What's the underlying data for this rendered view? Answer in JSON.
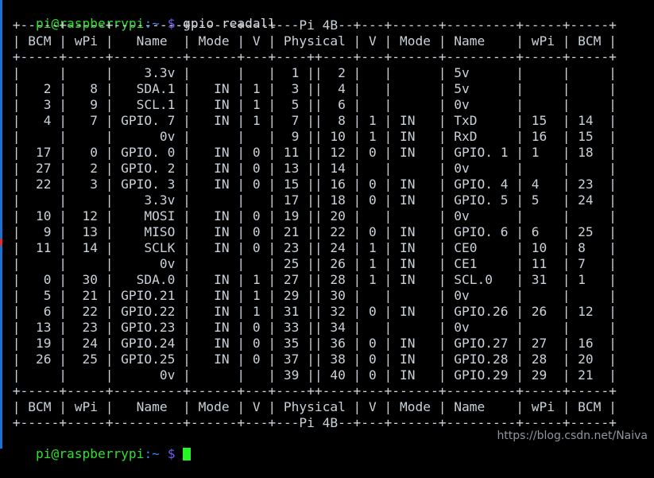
{
  "terminal": {
    "prompt": {
      "user_host": "pi@raspberrypi",
      "path": ":~",
      "dollar": "$"
    },
    "command": " gpio readall",
    "board": "Pi 4B",
    "watermark": "https://blog.csdn.net/Naiva",
    "colors": {
      "background": "#000000",
      "text": "#c9d1d9",
      "prompt_user": "#2ee02e",
      "prompt_path": "#3b82f6",
      "prompt_dollar": "#6f5cf0",
      "cursor": "#25f425",
      "scrollbar": "#1f6fd0",
      "scroll_mark": "#d83030"
    },
    "lines": [
      " +-----+-----+---------+------+---+---Pi 4B--+---+------+---------+-----+-----+",
      " | BCM | wPi |   Name  | Mode | V | Physical | V | Mode | Name    | wPi | BCM |",
      " +-----+-----+---------+------+---+----++----+---+------+---------+-----+-----+",
      " |     |     |    3.3v |      |   |  1 ||  2 |   |      | 5v      |     |     |",
      " |   2 |   8 |   SDA.1 |   IN | 1 |  3 ||  4 |   |      | 5v      |     |     |",
      " |   3 |   9 |   SCL.1 |   IN | 1 |  5 ||  6 |   |      | 0v      |     |     |",
      " |   4 |   7 | GPIO. 7 |   IN | 1 |  7 ||  8 | 1 | IN   | TxD     | 15  | 14  |",
      " |     |     |      0v |      |   |  9 || 10 | 1 | IN   | RxD     | 16  | 15  |",
      " |  17 |   0 | GPIO. 0 |   IN | 0 | 11 || 12 | 0 | IN   | GPIO. 1 | 1   | 18  |",
      " |  27 |   2 | GPIO. 2 |   IN | 0 | 13 || 14 |   |      | 0v      |     |     |",
      " |  22 |   3 | GPIO. 3 |   IN | 0 | 15 || 16 | 0 | IN   | GPIO. 4 | 4   | 23  |",
      " |     |     |    3.3v |      |   | 17 || 18 | 0 | IN   | GPIO. 5 | 5   | 24  |",
      " |  10 |  12 |    MOSI |   IN | 0 | 19 || 20 |   |      | 0v      |     |     |",
      " |   9 |  13 |    MISO |   IN | 0 | 21 || 22 | 0 | IN   | GPIO. 6 | 6   | 25  |",
      " |  11 |  14 |    SCLK |   IN | 0 | 23 || 24 | 1 | IN   | CE0     | 10  | 8   |",
      " |     |     |      0v |      |   | 25 || 26 | 1 | IN   | CE1     | 11  | 7   |",
      " |   0 |  30 |   SDA.0 |   IN | 1 | 27 || 28 | 1 | IN   | SCL.0   | 31  | 1   |",
      " |   5 |  21 | GPIO.21 |   IN | 1 | 29 || 30 |   |      | 0v      |     |     |",
      " |   6 |  22 | GPIO.22 |   IN | 1 | 31 || 32 | 0 | IN   | GPIO.26 | 26  | 12  |",
      " |  13 |  23 | GPIO.23 |   IN | 0 | 33 || 34 |   |      | 0v      |     |     |",
      " |  19 |  24 | GPIO.24 |   IN | 0 | 35 || 36 | 0 | IN   | GPIO.27 | 27  | 16  |",
      " |  26 |  25 | GPIO.25 |   IN | 0 | 37 || 38 | 0 | IN   | GPIO.28 | 28  | 20  |",
      " |     |     |      0v |      |   | 39 || 40 | 0 | IN   | GPIO.29 | 29  | 21  |",
      " +-----+-----+---------+------+---+----++----+---+------+---------+-----+-----+",
      " | BCM | wPi |   Name  | Mode | V | Physical | V | Mode | Name    | wPi | BCM |",
      " +-----+-----+---------+------+---+---Pi 4B--+---+------+---------+-----+-----+"
    ],
    "table": {
      "headers": [
        "BCM",
        "wPi",
        "Name",
        "Mode",
        "V",
        "Physical",
        "V",
        "Mode",
        "Name",
        "wPi",
        "BCM"
      ],
      "rows": [
        {
          "bcm_l": "",
          "wpi_l": "",
          "name_l": "3.3v",
          "mode_l": "",
          "v_l": "",
          "phys_l": "1",
          "phys_r": "2",
          "v_r": "",
          "mode_r": "",
          "name_r": "5v",
          "wpi_r": "",
          "bcm_r": ""
        },
        {
          "bcm_l": "2",
          "wpi_l": "8",
          "name_l": "SDA.1",
          "mode_l": "IN",
          "v_l": "1",
          "phys_l": "3",
          "phys_r": "4",
          "v_r": "",
          "mode_r": "",
          "name_r": "5v",
          "wpi_r": "",
          "bcm_r": ""
        },
        {
          "bcm_l": "3",
          "wpi_l": "9",
          "name_l": "SCL.1",
          "mode_l": "IN",
          "v_l": "1",
          "phys_l": "5",
          "phys_r": "6",
          "v_r": "",
          "mode_r": "",
          "name_r": "0v",
          "wpi_r": "",
          "bcm_r": ""
        },
        {
          "bcm_l": "4",
          "wpi_l": "7",
          "name_l": "GPIO. 7",
          "mode_l": "IN",
          "v_l": "1",
          "phys_l": "7",
          "phys_r": "8",
          "v_r": "1",
          "mode_r": "IN",
          "name_r": "TxD",
          "wpi_r": "15",
          "bcm_r": "14"
        },
        {
          "bcm_l": "",
          "wpi_l": "",
          "name_l": "0v",
          "mode_l": "",
          "v_l": "",
          "phys_l": "9",
          "phys_r": "10",
          "v_r": "1",
          "mode_r": "IN",
          "name_r": "RxD",
          "wpi_r": "16",
          "bcm_r": "15"
        },
        {
          "bcm_l": "17",
          "wpi_l": "0",
          "name_l": "GPIO. 0",
          "mode_l": "IN",
          "v_l": "0",
          "phys_l": "11",
          "phys_r": "12",
          "v_r": "0",
          "mode_r": "IN",
          "name_r": "GPIO. 1",
          "wpi_r": "1",
          "bcm_r": "18"
        },
        {
          "bcm_l": "27",
          "wpi_l": "2",
          "name_l": "GPIO. 2",
          "mode_l": "IN",
          "v_l": "0",
          "phys_l": "13",
          "phys_r": "14",
          "v_r": "",
          "mode_r": "",
          "name_r": "0v",
          "wpi_r": "",
          "bcm_r": ""
        },
        {
          "bcm_l": "22",
          "wpi_l": "3",
          "name_l": "GPIO. 3",
          "mode_l": "IN",
          "v_l": "0",
          "phys_l": "15",
          "phys_r": "16",
          "v_r": "0",
          "mode_r": "IN",
          "name_r": "GPIO. 4",
          "wpi_r": "4",
          "bcm_r": "23"
        },
        {
          "bcm_l": "",
          "wpi_l": "",
          "name_l": "3.3v",
          "mode_l": "",
          "v_l": "",
          "phys_l": "17",
          "phys_r": "18",
          "v_r": "0",
          "mode_r": "IN",
          "name_r": "GPIO. 5",
          "wpi_r": "5",
          "bcm_r": "24"
        },
        {
          "bcm_l": "10",
          "wpi_l": "12",
          "name_l": "MOSI",
          "mode_l": "IN",
          "v_l": "0",
          "phys_l": "19",
          "phys_r": "20",
          "v_r": "",
          "mode_r": "",
          "name_r": "0v",
          "wpi_r": "",
          "bcm_r": ""
        },
        {
          "bcm_l": "9",
          "wpi_l": "13",
          "name_l": "MISO",
          "mode_l": "IN",
          "v_l": "0",
          "phys_l": "21",
          "phys_r": "22",
          "v_r": "0",
          "mode_r": "IN",
          "name_r": "GPIO. 6",
          "wpi_r": "6",
          "bcm_r": "25"
        },
        {
          "bcm_l": "11",
          "wpi_l": "14",
          "name_l": "SCLK",
          "mode_l": "IN",
          "v_l": "0",
          "phys_l": "23",
          "phys_r": "24",
          "v_r": "1",
          "mode_r": "IN",
          "name_r": "CE0",
          "wpi_r": "10",
          "bcm_r": "8"
        },
        {
          "bcm_l": "",
          "wpi_l": "",
          "name_l": "0v",
          "mode_l": "",
          "v_l": "",
          "phys_l": "25",
          "phys_r": "26",
          "v_r": "1",
          "mode_r": "IN",
          "name_r": "CE1",
          "wpi_r": "11",
          "bcm_r": "7"
        },
        {
          "bcm_l": "0",
          "wpi_l": "30",
          "name_l": "SDA.0",
          "mode_l": "IN",
          "v_l": "1",
          "phys_l": "27",
          "phys_r": "28",
          "v_r": "1",
          "mode_r": "IN",
          "name_r": "SCL.0",
          "wpi_r": "31",
          "bcm_r": "1"
        },
        {
          "bcm_l": "5",
          "wpi_l": "21",
          "name_l": "GPIO.21",
          "mode_l": "IN",
          "v_l": "1",
          "phys_l": "29",
          "phys_r": "30",
          "v_r": "",
          "mode_r": "",
          "name_r": "0v",
          "wpi_r": "",
          "bcm_r": ""
        },
        {
          "bcm_l": "6",
          "wpi_l": "22",
          "name_l": "GPIO.22",
          "mode_l": "IN",
          "v_l": "1",
          "phys_l": "31",
          "phys_r": "32",
          "v_r": "0",
          "mode_r": "IN",
          "name_r": "GPIO.26",
          "wpi_r": "26",
          "bcm_r": "12"
        },
        {
          "bcm_l": "13",
          "wpi_l": "23",
          "name_l": "GPIO.23",
          "mode_l": "IN",
          "v_l": "0",
          "phys_l": "33",
          "phys_r": "34",
          "v_r": "",
          "mode_r": "",
          "name_r": "0v",
          "wpi_r": "",
          "bcm_r": ""
        },
        {
          "bcm_l": "19",
          "wpi_l": "24",
          "name_l": "GPIO.24",
          "mode_l": "IN",
          "v_l": "0",
          "phys_l": "35",
          "phys_r": "36",
          "v_r": "0",
          "mode_r": "IN",
          "name_r": "GPIO.27",
          "wpi_r": "27",
          "bcm_r": "16"
        },
        {
          "bcm_l": "26",
          "wpi_l": "25",
          "name_l": "GPIO.25",
          "mode_l": "IN",
          "v_l": "0",
          "phys_l": "37",
          "phys_r": "38",
          "v_r": "0",
          "mode_r": "IN",
          "name_r": "GPIO.28",
          "wpi_r": "28",
          "bcm_r": "20"
        },
        {
          "bcm_l": "",
          "wpi_l": "",
          "name_l": "0v",
          "mode_l": "",
          "v_l": "",
          "phys_l": "39",
          "phys_r": "40",
          "v_r": "0",
          "mode_r": "IN",
          "name_r": "GPIO.29",
          "wpi_r": "29",
          "bcm_r": "21"
        }
      ]
    }
  }
}
